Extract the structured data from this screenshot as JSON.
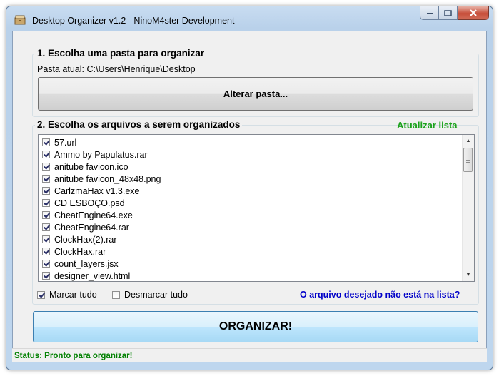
{
  "window": {
    "title": "Desktop Organizer v1.2 - NinoM4ster Development"
  },
  "folder_section": {
    "heading": "1. Escolha uma pasta para organizar",
    "current_path_label": "Pasta atual: C:\\Users\\Henrique\\Desktop",
    "change_button": "Alterar pasta..."
  },
  "files_section": {
    "heading": "2. Escolha os arquivos a serem organizados",
    "refresh_link": "Atualizar lista",
    "files": [
      {
        "name": "57.url",
        "checked": true
      },
      {
        "name": "Ammo by Papulatus.rar",
        "checked": true
      },
      {
        "name": "anitube favicon.ico",
        "checked": true
      },
      {
        "name": "anitube favicon_48x48.png",
        "checked": true
      },
      {
        "name": "CarlzmaHax v1.3.exe",
        "checked": true
      },
      {
        "name": "CD ESBOÇO.psd",
        "checked": true
      },
      {
        "name": "CheatEngine64.exe",
        "checked": true
      },
      {
        "name": "CheatEngine64.rar",
        "checked": true
      },
      {
        "name": "ClockHax(2).rar",
        "checked": true
      },
      {
        "name": "ClockHax.rar",
        "checked": true
      },
      {
        "name": "count_layers.jsx",
        "checked": true
      },
      {
        "name": "designer_view.html",
        "checked": true
      }
    ],
    "check_all_label": "Marcar tudo",
    "check_all_checked": true,
    "uncheck_all_label": "Desmarcar tudo",
    "uncheck_all_checked": false,
    "missing_file_link": "O arquivo desejado não está na lista?"
  },
  "organize_button": "ORGANIZAR!",
  "status": "Status: Pronto para organizar!",
  "colors": {
    "refresh_link": "#1ba11b",
    "missing_link": "#0000c8",
    "status_text": "#008000"
  }
}
